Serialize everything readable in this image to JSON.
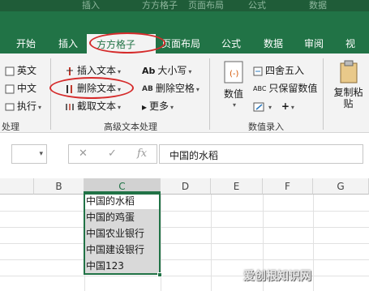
{
  "window": {
    "background_tabs": [
      "数据",
      "插入",
      "方方格子",
      "页面布局",
      "公式",
      "数据"
    ]
  },
  "ribbon_tabs": [
    {
      "label": "开始"
    },
    {
      "label": "插入"
    },
    {
      "label": "方方格子",
      "active": true
    },
    {
      "label": "页面布局"
    },
    {
      "label": "公式"
    },
    {
      "label": "数据"
    },
    {
      "label": "审阅"
    },
    {
      "label": "视"
    }
  ],
  "ribbon": {
    "left_group": {
      "items": [
        "英文",
        "中文",
        "执行"
      ],
      "label": "处理"
    },
    "text_group": {
      "label": "高级文本处理",
      "insert_text": "插入文本",
      "delete_text": "删除文本",
      "extract_text": "截取文本",
      "case": "大小写",
      "delete_space": "删除空格",
      "more": "更多"
    },
    "numeric_group": {
      "label": "数值录入",
      "value": "数值",
      "round": "四舍五入",
      "keep_value": "只保留数值"
    },
    "paste_group": {
      "copy": "复制粘",
      "paste": "贴"
    }
  },
  "formula_bar": {
    "value": "中国的水稻",
    "fx": "fx"
  },
  "grid": {
    "columns": [
      "B",
      "C",
      "D",
      "E",
      "F",
      "G"
    ],
    "selected_column": "C",
    "cells": [
      "中国的水稻",
      "中国的鸡蛋",
      "中国农业银行",
      "中国建设银行",
      "中国123"
    ]
  },
  "watermark": "爱创根知识网",
  "colors": {
    "accent": "#217346",
    "highlight_circle": "#d52b2b",
    "selected_fill": "#d9d9d9"
  }
}
